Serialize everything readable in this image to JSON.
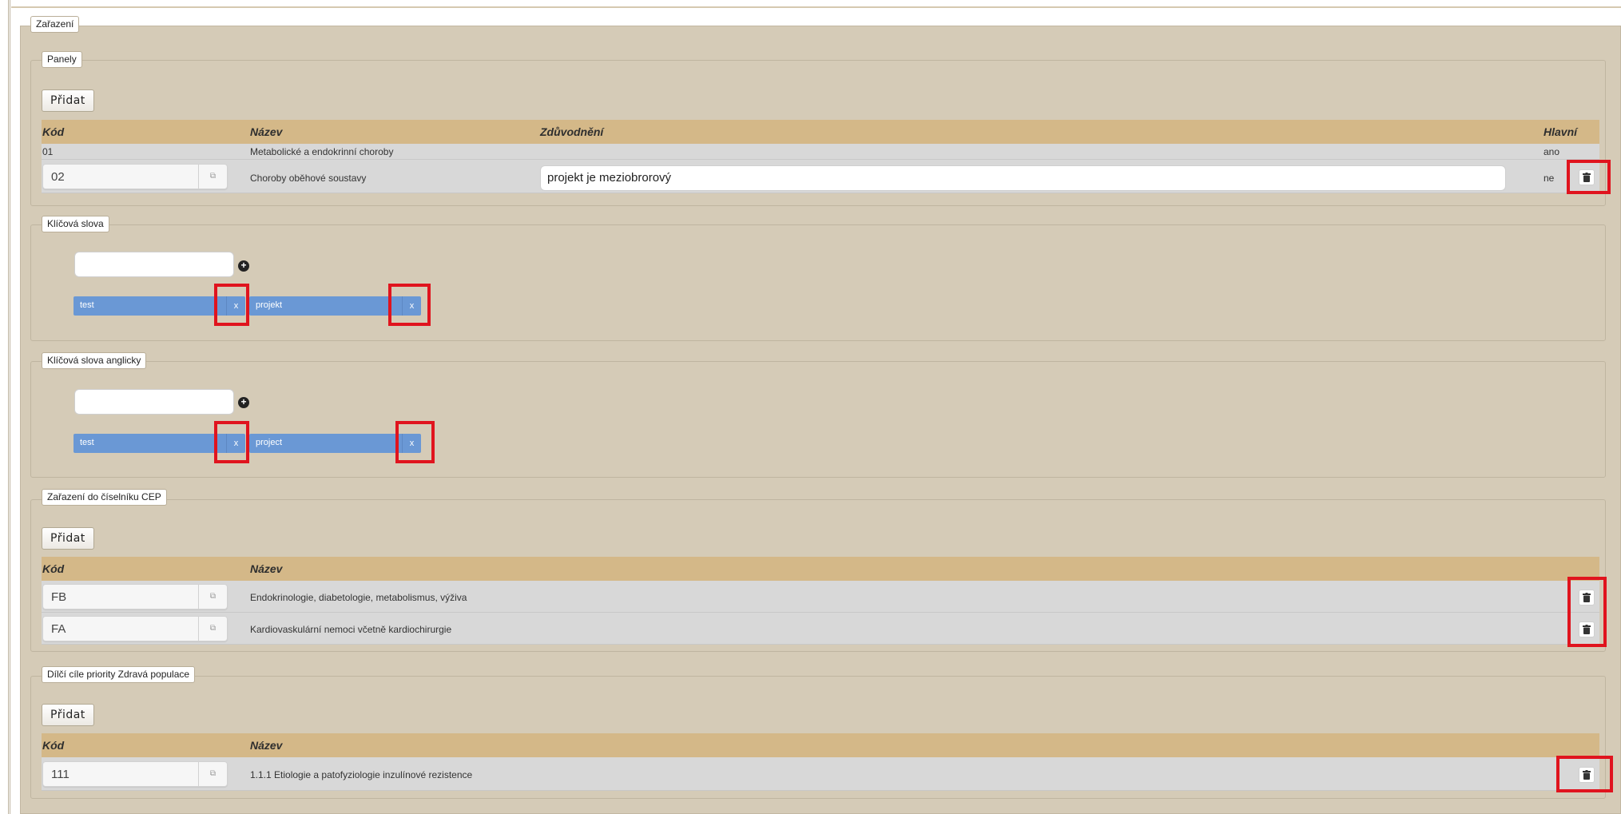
{
  "section_title": "Zařazení",
  "panely": {
    "legend": "Panely",
    "add_label": "Přidat",
    "headers": {
      "kod": "Kód",
      "nazev": "Název",
      "zduvodneni": "Zdůvodnění",
      "hlavni": "Hlavní"
    },
    "rows": [
      {
        "kod": "01",
        "nazev": "Metabolické a endokrinní choroby",
        "zduvodneni": "",
        "hlavni": "ano"
      },
      {
        "kod": "02",
        "nazev": "Choroby oběhové soustavy",
        "zduvodneni": "projekt je meziobrorový",
        "hlavni": "ne"
      }
    ]
  },
  "klicova_slova": {
    "legend": "Klíčová slova",
    "input_value": "",
    "tags": [
      {
        "label": "test",
        "remove": "x"
      },
      {
        "label": "projekt",
        "remove": "x"
      }
    ]
  },
  "klicova_slova_en": {
    "legend": "Klíčová slova anglicky",
    "input_value": "",
    "tags": [
      {
        "label": "test",
        "remove": "x"
      },
      {
        "label": "project",
        "remove": "x"
      }
    ]
  },
  "cep": {
    "legend": "Zařazení do číselníku CEP",
    "add_label": "Přidat",
    "headers": {
      "kod": "Kód",
      "nazev": "Název"
    },
    "rows": [
      {
        "kod": "FB",
        "nazev": "Endokrinologie, diabetologie, metabolismus, výživa"
      },
      {
        "kod": "FA",
        "nazev": "Kardiovaskulární nemoci včetně kardiochirurgie"
      }
    ]
  },
  "dilci": {
    "legend": "Dílčí cíle priority Zdravá populace",
    "add_label": "Přidat",
    "headers": {
      "kod": "Kód",
      "nazev": "Název"
    },
    "rows": [
      {
        "kod": "111",
        "nazev": "1.1.1 Etiologie a patofyziologie inzulínové rezistence"
      }
    ]
  },
  "colors": {
    "highlight": "#e0141e",
    "tag": "#6a98d5",
    "header": "#d4b888",
    "panel": "#d5cbb7"
  },
  "icons": {
    "trash": "trash-icon",
    "lookup": "lookup-icon",
    "add": "plus-circle-icon"
  }
}
